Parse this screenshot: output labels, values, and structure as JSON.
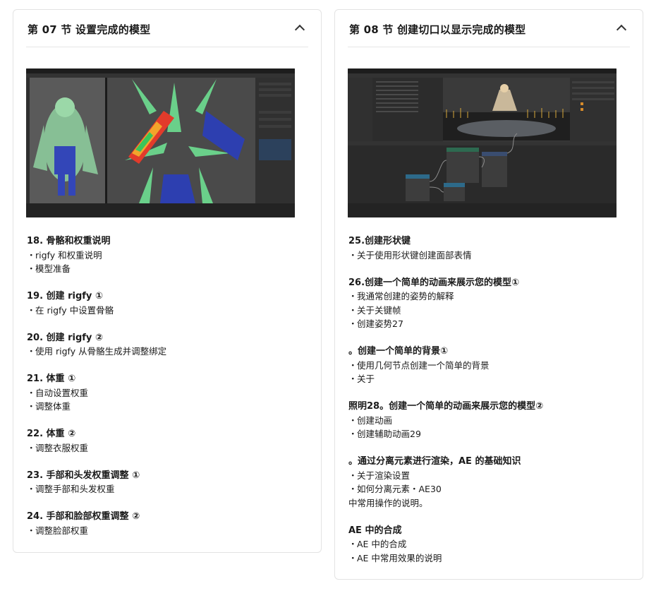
{
  "left_card": {
    "title": "第 07 节 设置完成的模型",
    "sections": [
      {
        "title": "18. 骨骼和权重说明",
        "items": [
          "rigfy 和权重说明",
          "模型准备"
        ]
      },
      {
        "title": "19. 创建 rigfy ①",
        "items": [
          "在 rigfy 中设置骨骼"
        ]
      },
      {
        "title": "20. 创建 rigfy ②",
        "items": [
          "使用 rigfy 从骨骼生成并调整绑定"
        ]
      },
      {
        "title": "21. 体重 ①",
        "items": [
          "自动设置权重",
          "调整体重"
        ]
      },
      {
        "title": "22. 体重 ②",
        "items": [
          "调整衣服权重"
        ]
      },
      {
        "title": "23. 手部和头发权重调整 ①",
        "items": [
          "调整手部和头发权重"
        ]
      },
      {
        "title": "24. 手部和脸部权重调整 ②",
        "items": [
          "调整脸部权重"
        ]
      }
    ]
  },
  "right_card": {
    "title": "第 08 节 创建切口以显示完成的模型",
    "sections": [
      {
        "title": "25.创建形状键",
        "items": [
          "关于使用形状键创建面部表情"
        ]
      },
      {
        "title": "26.创建一个简单的动画来展示您的模型①",
        "items": [
          "我通常创建的姿势的解释",
          "关于关键帧",
          "创建姿势27"
        ]
      },
      {
        "title": "。创建一个简单的背景①",
        "items": [
          "使用几何节点创建一个简单的背景",
          "关于"
        ]
      },
      {
        "title": "照明28。创建一个简单的动画来展示您的模型②",
        "items": [
          "创建动画",
          "创建辅助动画29"
        ]
      },
      {
        "title": "。通过分离元素进行渲染，AE 的基础知识",
        "items": [
          "关于渲染设置",
          "如何分离元素・AE30"
        ],
        "note": "中常用操作的说明。"
      },
      {
        "title": "AE 中的合成",
        "items": [
          "AE 中的合成",
          "AE 中常用效果的说明"
        ]
      }
    ]
  },
  "bullet": "・",
  "colors": {
    "card_border": "#e3e3e3",
    "divider": "#e6e6e6",
    "text": "#1a1a1a",
    "blender_bg": "#2b2b2b"
  }
}
